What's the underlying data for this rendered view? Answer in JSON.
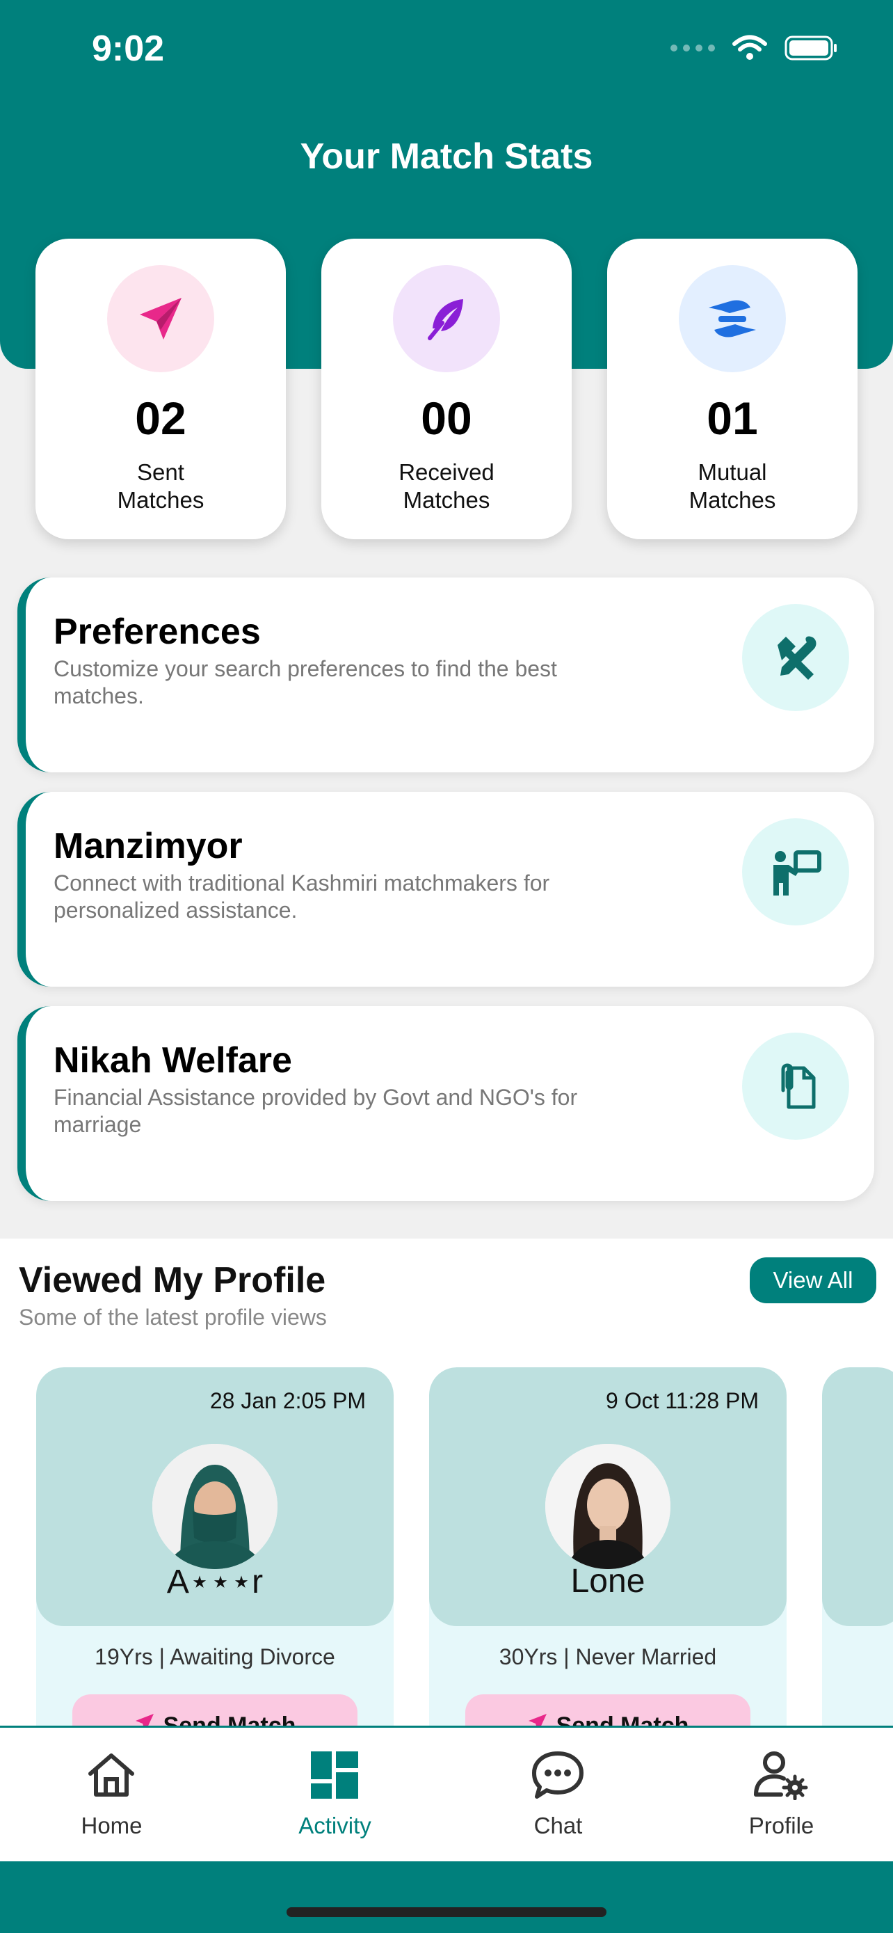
{
  "status_bar": {
    "time": "9:02"
  },
  "header": {
    "title": "Your Match Stats"
  },
  "stats": [
    {
      "value": "02",
      "label_line1": "Sent",
      "label_line2": "Matches",
      "icon": "paper-plane-icon",
      "icon_color": "#e8288a",
      "bg_color": "#fde4ee"
    },
    {
      "value": "00",
      "label_line1": "Received",
      "label_line2": "Matches",
      "icon": "feather-icon",
      "icon_color": "#8a1fd6",
      "bg_color": "#f2e3fb"
    },
    {
      "value": "01",
      "label_line1": "Mutual",
      "label_line2": "Matches",
      "icon": "handshake-icon",
      "icon_color": "#1f6fe0",
      "bg_color": "#e3efff"
    }
  ],
  "features": [
    {
      "title": "Preferences",
      "description": "Customize your search preferences to find the best matches.",
      "icon": "tools-icon"
    },
    {
      "title": "Manzimyor",
      "description": "Connect with traditional Kashmiri matchmakers for personalized assistance.",
      "icon": "presenter-icon"
    },
    {
      "title": "Nikah Welfare",
      "description": "Financial Assistance provided by Govt and NGO's for marriage",
      "icon": "document-clip-icon"
    }
  ],
  "viewed": {
    "title": "Viewed My Profile",
    "subtitle": "Some of the latest profile views",
    "view_all_label": "View All",
    "profiles": [
      {
        "date": "28 Jan 2:05 PM",
        "name": "A⋆⋆⋆r",
        "info": "19Yrs | Awaiting Divorce",
        "button_label": "Send Match"
      },
      {
        "date": "9 Oct 11:28 PM",
        "name": "Lone",
        "info": "30Yrs | Never Married",
        "button_label": "Send Match"
      }
    ]
  },
  "tabs": [
    {
      "label": "Home",
      "icon": "home-icon"
    },
    {
      "label": "Activity",
      "icon": "dashboard-icon",
      "active": true
    },
    {
      "label": "Chat",
      "icon": "chat-bubble-icon"
    },
    {
      "label": "Profile",
      "icon": "user-settings-icon"
    }
  ],
  "colors": {
    "brand": "#00807c",
    "send_button": "#fbc9e1"
  }
}
